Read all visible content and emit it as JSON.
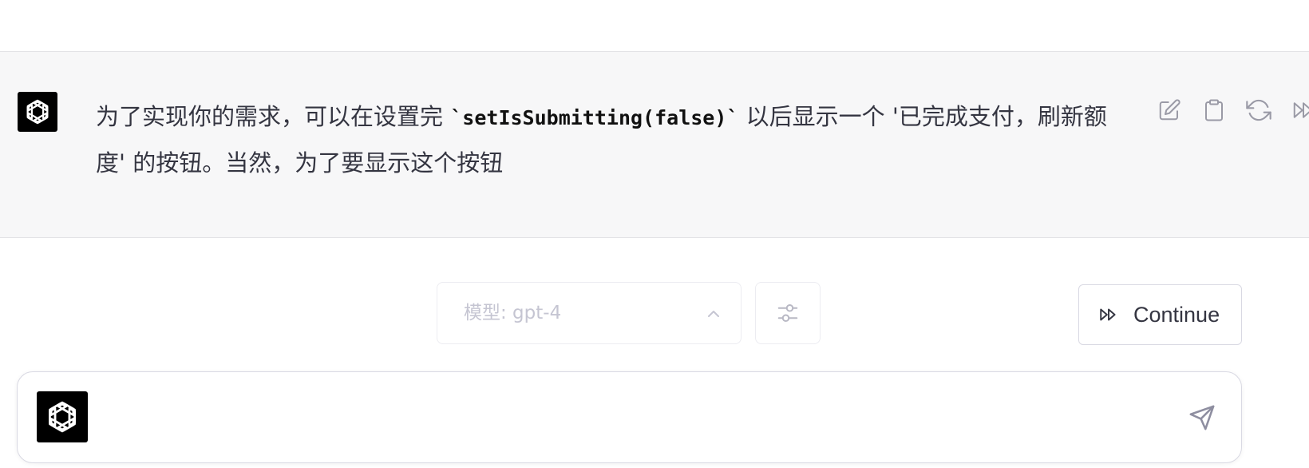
{
  "message": {
    "text_before": "为了实现你的需求，可以在设置完 ",
    "code": "`setIsSubmitting(false)`",
    "text_after": " 以后显示一个 '已完成支付，刷新额度' 的按钮。当然，为了要显示这个按钮",
    "actions": [
      "edit-icon",
      "clipboard-icon",
      "regenerate-icon",
      "continue-icon"
    ]
  },
  "controls": {
    "model_label": "模型: gpt-4",
    "continue_label": "Continue"
  },
  "input": {
    "placeholder": "",
    "value": ""
  },
  "colors": {
    "message_bg": "#f7f7f8",
    "avatar_bg": "#000000",
    "text": "#343541",
    "muted": "#c5c5d2",
    "border": "#d9d9e3"
  }
}
